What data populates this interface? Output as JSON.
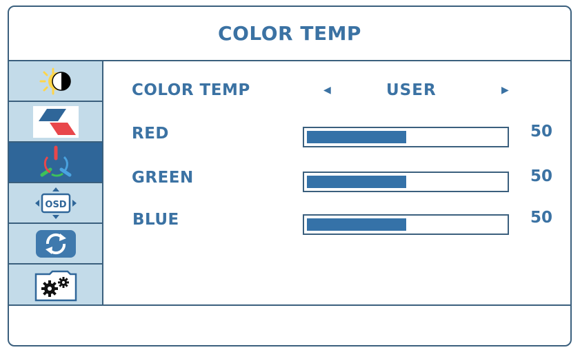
{
  "header": {
    "title": "COLOR TEMP"
  },
  "sidebar": {
    "items": [
      {
        "icon": "brightness-contrast-icon"
      },
      {
        "icon": "picture-icon"
      },
      {
        "icon": "color-icon",
        "active": true
      },
      {
        "icon": "osd-icon",
        "icon_text": "OSD"
      },
      {
        "icon": "reset-icon"
      },
      {
        "icon": "settings-gears-icon"
      }
    ]
  },
  "settings": {
    "color_temp": {
      "label": "COLOR TEMP",
      "value": "USER"
    },
    "red": {
      "label": "RED",
      "value": "50",
      "level": 50
    },
    "green": {
      "label": "GREEN",
      "value": "50",
      "level": 50
    },
    "blue": {
      "label": "BLUE",
      "value": "50",
      "level": 50
    }
  },
  "colors": {
    "accent": "#3b72a3",
    "border": "#3a5f7d",
    "sidebar_bg": "#c3dbe9",
    "sidebar_active": "#2f6699",
    "bar_fill": "#3572a8"
  }
}
